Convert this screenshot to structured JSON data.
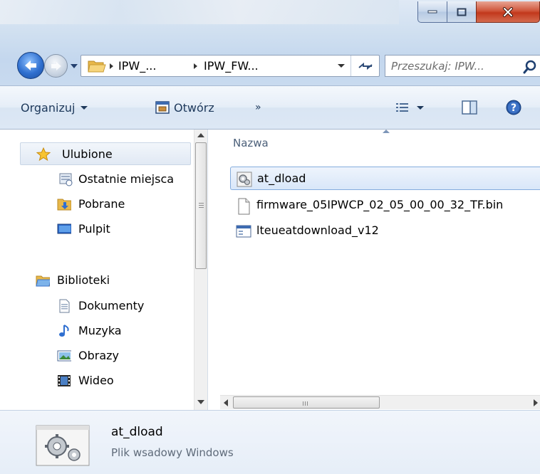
{
  "window": {
    "caption_buttons": [
      "minimize",
      "maximize",
      "close"
    ],
    "accent_close": "#c2381c"
  },
  "address_bar": {
    "crumbs": [
      "IPW_...",
      "IPW_FW..."
    ],
    "search_placeholder": "Przeszukaj: IPW..."
  },
  "toolbar": {
    "organize_label": "Organizuj",
    "open_label": "Otwórz",
    "more_label": "»"
  },
  "nav_pane": {
    "favorites_label": "Ulubione",
    "favorites": [
      "Ostatnie miejsca",
      "Pobrane",
      "Pulpit"
    ],
    "libraries_label": "Biblioteki",
    "libraries": [
      "Dokumenty",
      "Muzyka",
      "Obrazy",
      "Wideo"
    ]
  },
  "file_list": {
    "column_header": "Nazwa",
    "items": [
      {
        "name": "at_dload",
        "icon": "batch-file-icon",
        "selected": true
      },
      {
        "name": "firmware_05IPWCP_02_05_00_00_32_TF.bin",
        "icon": "blank-file-icon",
        "selected": false
      },
      {
        "name": "lteueatdownload_v12",
        "icon": "application-icon",
        "selected": false
      }
    ]
  },
  "details_pane": {
    "name": "at_dload",
    "type": "Plik wsadowy Windows"
  }
}
